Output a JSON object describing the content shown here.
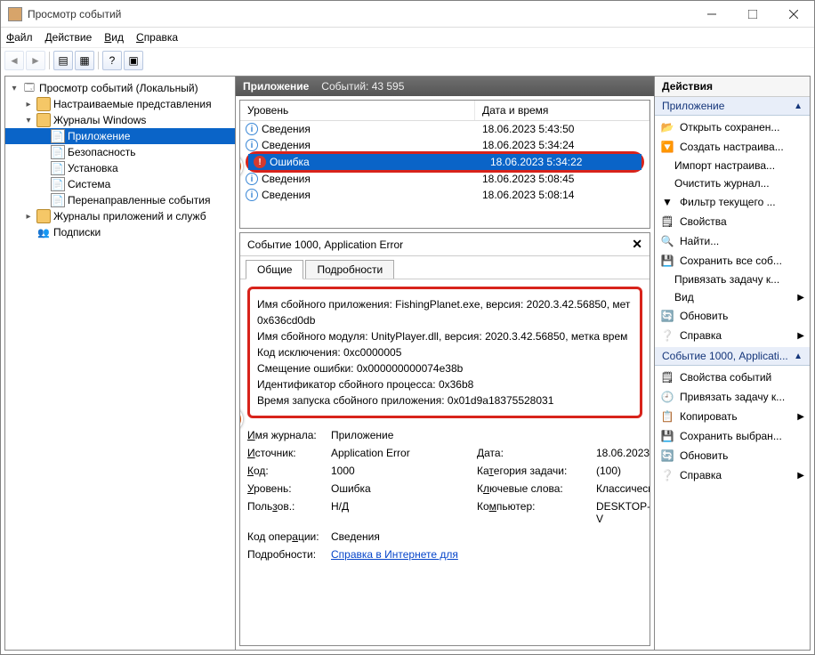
{
  "window": {
    "title": "Просмотр событий"
  },
  "menu": {
    "file": "Файл",
    "action": "Действие",
    "view": "Вид",
    "help": "Справка"
  },
  "tree": {
    "root": "Просмотр событий (Локальный)",
    "custom": "Настраиваемые представления",
    "winlogs": "Журналы Windows",
    "app": "Приложение",
    "sec": "Безопасность",
    "setup": "Установка",
    "sys": "Система",
    "fwd": "Перенаправленные события",
    "appsvc": "Журналы приложений и служб",
    "subs": "Подписки"
  },
  "listHeader": {
    "title": "Приложение",
    "countLabel": "Событий: 43 595",
    "level": "Уровень",
    "date": "Дата и время"
  },
  "rows": [
    {
      "icon": "inf",
      "level": "Сведения",
      "date": "18.06.2023 5:43:50"
    },
    {
      "icon": "inf",
      "level": "Сведения",
      "date": "18.06.2023 5:34:24"
    },
    {
      "icon": "err",
      "level": "Ошибка",
      "date": "18.06.2023 5:34:22"
    },
    {
      "icon": "inf",
      "level": "Сведения",
      "date": "18.06.2023 5:08:45"
    },
    {
      "icon": "inf",
      "level": "Сведения",
      "date": "18.06.2023 5:08:14"
    }
  ],
  "detail": {
    "title": "Событие 1000, Application Error",
    "tab_general": "Общие",
    "tab_details": "Подробности",
    "lines": [
      "Имя сбойного приложения: FishingPlanet.exe, версия: 2020.3.42.56850, мет",
      "0x636cd0db",
      "Имя сбойного модуля: UnityPlayer.dll, версия: 2020.3.42.56850, метка врем",
      "Код исключения: 0xc0000005",
      "Смещение ошибки: 0x000000000074e38b",
      "Идентификатор сбойного процесса: 0x36b8",
      "Время запуска сбойного приложения: 0x01d9a18375528031"
    ],
    "meta": {
      "logname_l": "Имя журнала:",
      "logname_v": "Приложение",
      "source_l": "Источник:",
      "source_v": "Application Error",
      "date_l": "Дата:",
      "date_v": "18.06.2023",
      "code_l": "Код:",
      "code_v": "1000",
      "cat_l": "Категория задачи:",
      "cat_v": "(100)",
      "level_l": "Уровень:",
      "level_v": "Ошибка",
      "keyw_l": "Ключевые слова:",
      "keyw_v": "Классическ",
      "user_l": "Пользов.:",
      "user_v": "Н/Д",
      "comp_l": "Компьютер:",
      "comp_v": "DESKTOP-V",
      "opcode_l": "Код операции:",
      "opcode_v": "Сведения",
      "morehelp_l": "Подробности:",
      "morehelp_link": "Справка в Интернете для"
    }
  },
  "actions": {
    "title": "Действия",
    "sec_app": "Приложение",
    "open_saved": "Открыть сохранен...",
    "create_custom": "Создать настраива...",
    "import_custom": "Импорт настраива...",
    "clear_log": "Очистить журнал...",
    "filter": "Фильтр текущего ...",
    "props": "Свойства",
    "find": "Найти...",
    "save_all": "Сохранить все соб...",
    "attach": "Привязать задачу к...",
    "view": "Вид",
    "refresh": "Обновить",
    "help": "Справка",
    "sec_evt": "Событие 1000, Applicati...",
    "evt_props": "Свойства событий",
    "evt_attach": "Привязать задачу к...",
    "copy": "Копировать",
    "save_sel": "Сохранить выбран...",
    "refresh2": "Обновить",
    "help2": "Справка"
  }
}
